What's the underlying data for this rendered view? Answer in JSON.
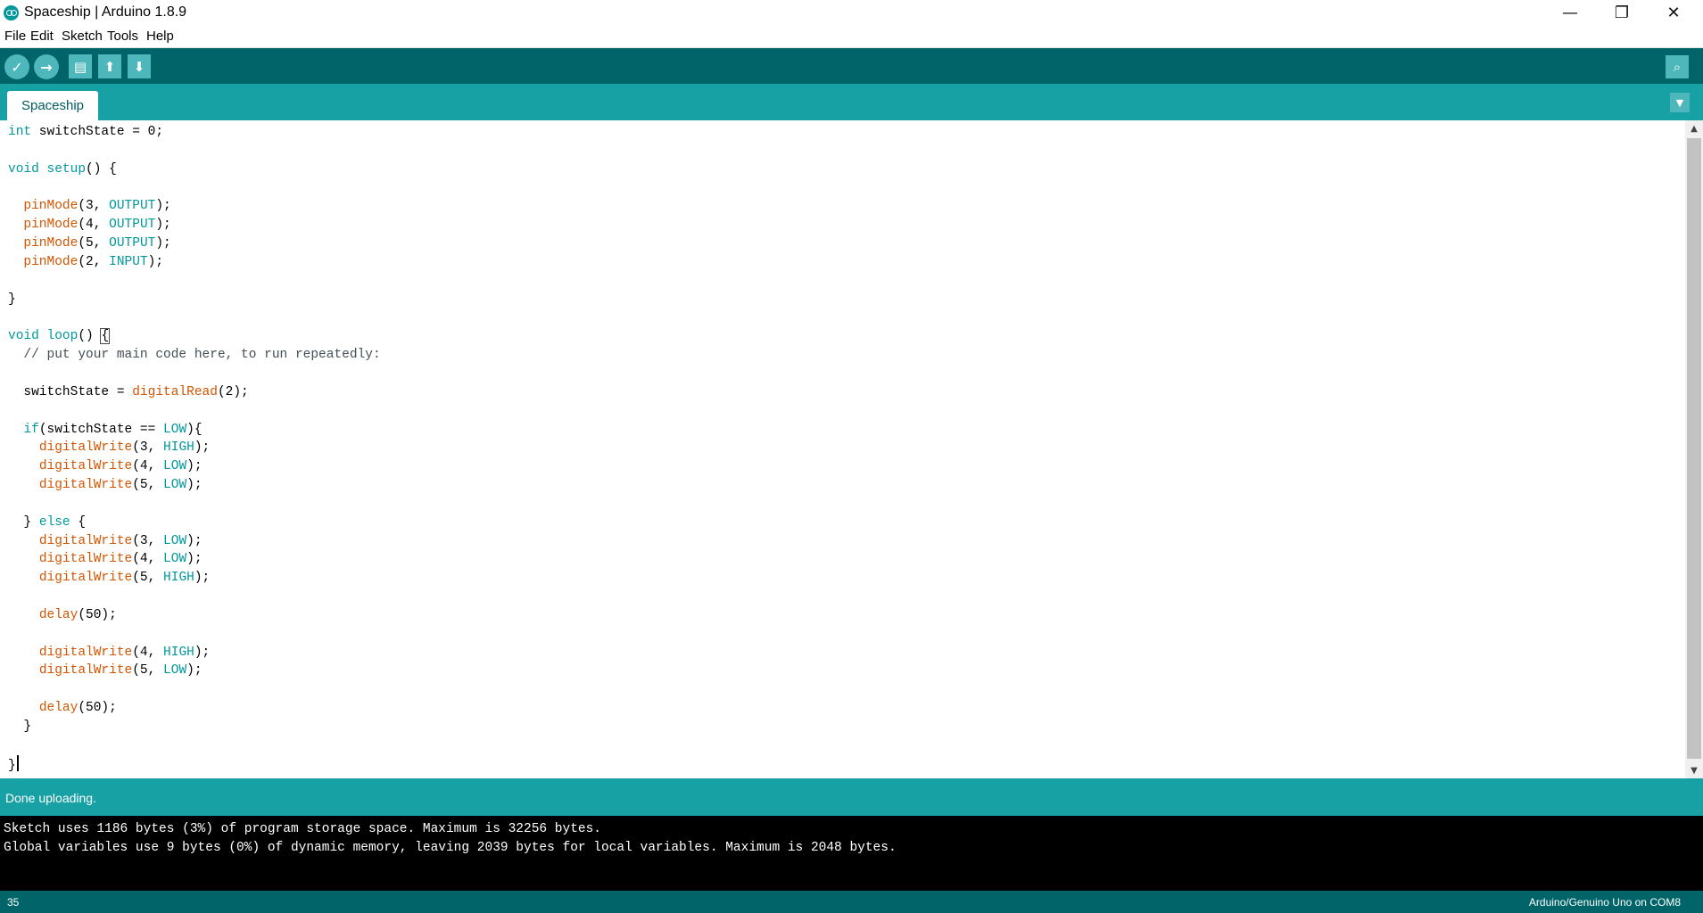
{
  "window": {
    "title": "Spaceship | Arduino 1.8.9",
    "controls": {
      "minimize": "—",
      "restore": "❐",
      "close": "✕"
    }
  },
  "menu": [
    "File",
    "Edit",
    "Sketch",
    "Tools",
    "Help"
  ],
  "toolbar": {
    "verify_icon": "✓",
    "upload_icon": "→",
    "new_icon": "▤",
    "open_icon": "⬆",
    "save_icon": "⬇",
    "serial_monitor_icon": "⌕"
  },
  "tabs": [
    {
      "label": "Spaceship"
    }
  ],
  "tab_menu_icon": "▼",
  "code_lines": [
    [
      {
        "t": "int",
        "c": "kw"
      },
      {
        "t": " switchState = 0;"
      }
    ],
    [],
    [
      {
        "t": "void",
        "c": "kw"
      },
      {
        "t": " "
      },
      {
        "t": "setup",
        "c": "kw"
      },
      {
        "t": "() {"
      }
    ],
    [],
    [
      {
        "t": "  "
      },
      {
        "t": "pinMode",
        "c": "fn"
      },
      {
        "t": "(3, "
      },
      {
        "t": "OUTPUT",
        "c": "kw"
      },
      {
        "t": ");"
      }
    ],
    [
      {
        "t": "  "
      },
      {
        "t": "pinMode",
        "c": "fn"
      },
      {
        "t": "(4, "
      },
      {
        "t": "OUTPUT",
        "c": "kw"
      },
      {
        "t": ");"
      }
    ],
    [
      {
        "t": "  "
      },
      {
        "t": "pinMode",
        "c": "fn"
      },
      {
        "t": "(5, "
      },
      {
        "t": "OUTPUT",
        "c": "kw"
      },
      {
        "t": ");"
      }
    ],
    [
      {
        "t": "  "
      },
      {
        "t": "pinMode",
        "c": "fn"
      },
      {
        "t": "(2, "
      },
      {
        "t": "INPUT",
        "c": "kw"
      },
      {
        "t": ");"
      }
    ],
    [],
    [
      {
        "t": "}"
      }
    ],
    [],
    [
      {
        "t": "void",
        "c": "kw"
      },
      {
        "t": " "
      },
      {
        "t": "loop",
        "c": "kw"
      },
      {
        "t": "() "
      },
      {
        "t": "{",
        "c": "bracket-box"
      }
    ],
    [
      {
        "t": "  // put your main code here, to run repeatedly:",
        "c": "cm"
      }
    ],
    [],
    [
      {
        "t": "  switchState = "
      },
      {
        "t": "digitalRead",
        "c": "fn"
      },
      {
        "t": "(2);"
      }
    ],
    [],
    [
      {
        "t": "  "
      },
      {
        "t": "if",
        "c": "kw"
      },
      {
        "t": "(switchState == "
      },
      {
        "t": "LOW",
        "c": "kw"
      },
      {
        "t": "){"
      }
    ],
    [
      {
        "t": "    "
      },
      {
        "t": "digitalWrite",
        "c": "fn"
      },
      {
        "t": "(3, "
      },
      {
        "t": "HIGH",
        "c": "kw"
      },
      {
        "t": ");"
      }
    ],
    [
      {
        "t": "    "
      },
      {
        "t": "digitalWrite",
        "c": "fn"
      },
      {
        "t": "(4, "
      },
      {
        "t": "LOW",
        "c": "kw"
      },
      {
        "t": ");"
      }
    ],
    [
      {
        "t": "    "
      },
      {
        "t": "digitalWrite",
        "c": "fn"
      },
      {
        "t": "(5, "
      },
      {
        "t": "LOW",
        "c": "kw"
      },
      {
        "t": ");"
      }
    ],
    [],
    [
      {
        "t": "  } "
      },
      {
        "t": "else",
        "c": "kw"
      },
      {
        "t": " {"
      }
    ],
    [
      {
        "t": "    "
      },
      {
        "t": "digitalWrite",
        "c": "fn"
      },
      {
        "t": "(3, "
      },
      {
        "t": "LOW",
        "c": "kw"
      },
      {
        "t": ");"
      }
    ],
    [
      {
        "t": "    "
      },
      {
        "t": "digitalWrite",
        "c": "fn"
      },
      {
        "t": "(4, "
      },
      {
        "t": "LOW",
        "c": "kw"
      },
      {
        "t": ");"
      }
    ],
    [
      {
        "t": "    "
      },
      {
        "t": "digitalWrite",
        "c": "fn"
      },
      {
        "t": "(5, "
      },
      {
        "t": "HIGH",
        "c": "kw"
      },
      {
        "t": ");"
      }
    ],
    [],
    [
      {
        "t": "    "
      },
      {
        "t": "delay",
        "c": "fn"
      },
      {
        "t": "(50);"
      }
    ],
    [],
    [
      {
        "t": "    "
      },
      {
        "t": "digitalWrite",
        "c": "fn"
      },
      {
        "t": "(4, "
      },
      {
        "t": "HIGH",
        "c": "kw"
      },
      {
        "t": ");"
      }
    ],
    [
      {
        "t": "    "
      },
      {
        "t": "digitalWrite",
        "c": "fn"
      },
      {
        "t": "(5, "
      },
      {
        "t": "LOW",
        "c": "kw"
      },
      {
        "t": ");"
      }
    ],
    [],
    [
      {
        "t": "    "
      },
      {
        "t": "delay",
        "c": "fn"
      },
      {
        "t": "(50);"
      }
    ],
    [
      {
        "t": "  }"
      }
    ],
    [],
    [
      {
        "t": "}"
      },
      {
        "caret": true
      }
    ]
  ],
  "scrollbar": {
    "up": "▲",
    "down": "▼"
  },
  "status": {
    "message": "Done uploading."
  },
  "console": {
    "lines": [
      "Sketch uses 1186 bytes (3%) of program storage space. Maximum is 32256 bytes.",
      "Global variables use 9 bytes (0%) of dynamic memory, leaving 2039 bytes for local variables. Maximum is 2048 bytes."
    ]
  },
  "footer": {
    "line_number": "35",
    "board": "Arduino/Genuino Uno on COM8"
  },
  "colors": {
    "toolbar": "#006468",
    "tabbar": "#17a1a5",
    "keyword": "#00979c",
    "function": "#d35400",
    "comment": "#434f54"
  }
}
